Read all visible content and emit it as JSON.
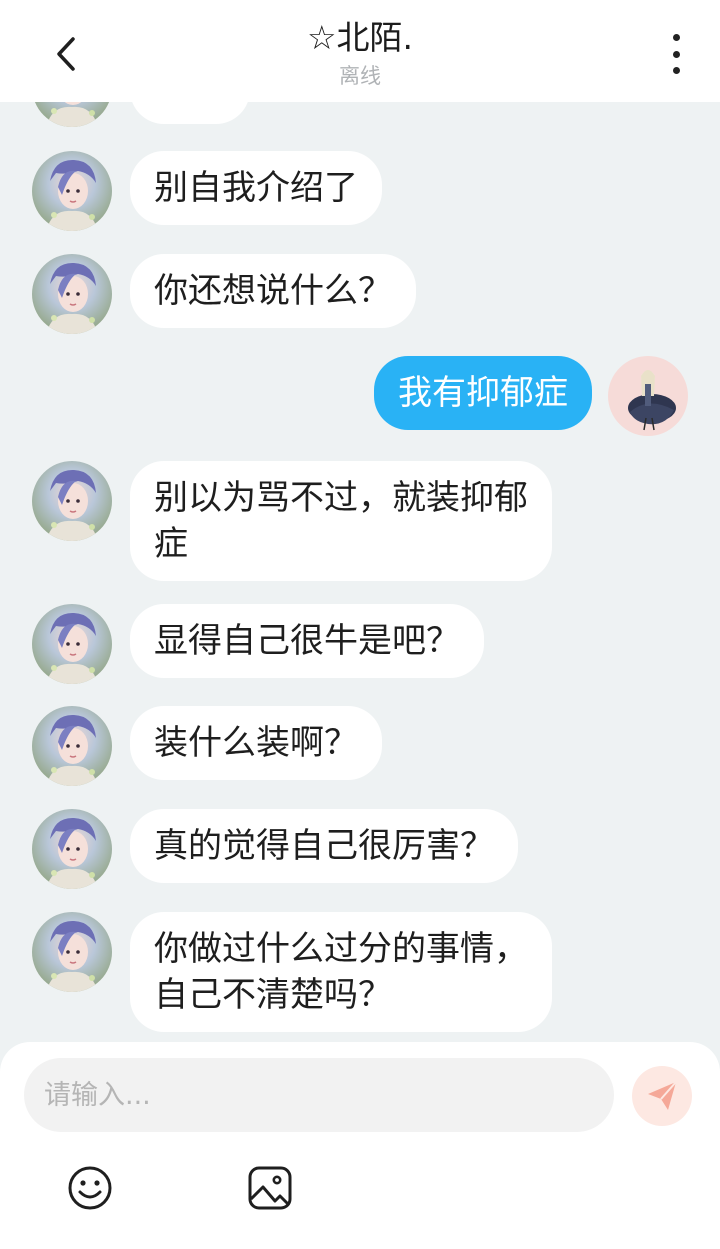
{
  "header": {
    "title": "☆北陌.",
    "status": "离线"
  },
  "messages": [
    {
      "sender": "other",
      "text": ""
    },
    {
      "sender": "other",
      "text": "别自我介绍了"
    },
    {
      "sender": "other",
      "text": "你还想说什么？"
    },
    {
      "sender": "me",
      "text": "我有抑郁症"
    },
    {
      "sender": "other",
      "text": "别以为骂不过，就装抑郁\n症"
    },
    {
      "sender": "other",
      "text": "显得自己很牛是吧？"
    },
    {
      "sender": "other",
      "text": "装什么装啊？"
    },
    {
      "sender": "other",
      "text": "真的觉得自己很厉害？"
    },
    {
      "sender": "other",
      "text": "你做过什么过分的事情，\n自己不清楚吗？"
    }
  ],
  "composer": {
    "placeholder": "请输入...",
    "send_icon": "send-icon",
    "tools": [
      "emoji-icon",
      "image-icon"
    ]
  },
  "colors": {
    "chat_background": "#eef2f3",
    "my_bubble": "#29b2f5",
    "other_bubble": "#ffffff",
    "send_button_bg": "#fde8e2",
    "send_icon": "#f5a898"
  }
}
